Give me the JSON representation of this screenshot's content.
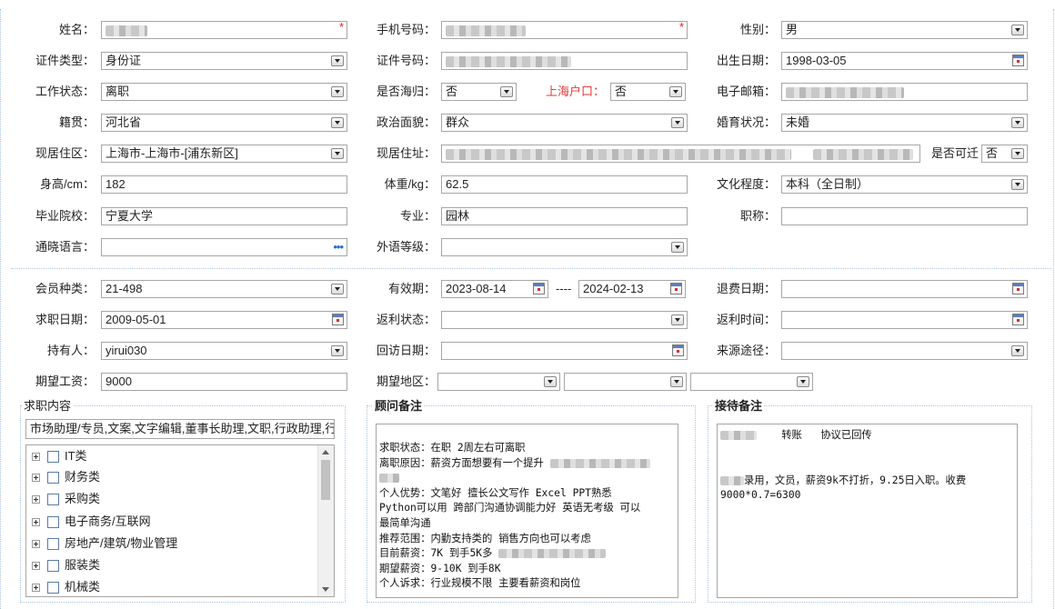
{
  "personal": {
    "name_label": "姓名：",
    "mobile_label": "手机号码：",
    "gender_label": "性别：",
    "gender": "男",
    "id_type_label": "证件类型：",
    "id_type": "身份证",
    "id_no_label": "证件号码：",
    "birth_label": "出生日期：",
    "birth": "1998-03-05",
    "work_status_label": "工作状态：",
    "work_status": "离职",
    "returnee_label": "是否海归：",
    "returnee": "否",
    "hukou_label": "上海户口：",
    "hukou": "否",
    "email_label": "电子邮箱：",
    "native_label": "籍贯：",
    "native": "河北省",
    "political_label": "政治面貌：",
    "political": "群众",
    "marital_label": "婚育状况：",
    "marital": "未婚",
    "residence_area_label": "现居住区：",
    "residence_area": "上海市-上海市-[浦东新区]",
    "address_label": "现居住址：",
    "relocate_label": "是否可迁",
    "relocate": "否",
    "height_label": "身高/cm：",
    "height": "182",
    "weight_label": "体重/kg：",
    "weight": "62.5",
    "education_label": "文化程度：",
    "education": "本科（全日制）",
    "school_label": "毕业院校：",
    "school": "宁夏大学",
    "major_label": "专业：",
    "major": "园林",
    "title_label": "职称：",
    "language_label": "通晓语言：",
    "foreign_level_label": "外语等级："
  },
  "member": {
    "type_label": "会员种类：",
    "type": "21-498",
    "valid_label": "有效期：",
    "valid_from": "2023-08-14",
    "valid_sep": "----",
    "valid_to": "2024-02-13",
    "refund_date_label": "退费日期：",
    "job_date_label": "求职日期：",
    "job_date": "2009-05-01",
    "rebate_status_label": "返利状态：",
    "rebate_time_label": "返利时间：",
    "holder_label": "持有人：",
    "holder": "yirui030",
    "visit_label": "回访日期：",
    "source_label": "来源途径：",
    "salary_label": "期望工资：",
    "salary": "9000",
    "region_label": "期望地区："
  },
  "job_panel": {
    "title": "求职内容",
    "summary": "市场助理/专员,文案,文字编辑,董事长助理,文职,行政助理,行",
    "tree": [
      "IT类",
      "财务类",
      "采购类",
      "电子商务/互联网",
      "房地产/建筑/物业管理",
      "服装类",
      "机械类"
    ]
  },
  "consultant": {
    "title": "顾问备注",
    "lines": [
      "求职状态：在职 2周左右可离职",
      "离职原因：薪资方面想要有一个提升",
      "",
      "个人优势：文笔好 擅长公文写作 Excel PPT熟悉",
      "Python可以用 跨部门沟通协调能力好 英语无考级 可以",
      "最简单沟通",
      "推荐范围：内勤支持类的 销售方向也可以考虑",
      "目前薪资：7K 到手5K多",
      "期望薪资：9-10K 到手8K",
      "个人诉求：行业规模不限 主要看薪资和岗位"
    ]
  },
  "reception": {
    "title": "接待备注",
    "line1_a": "转账",
    "line1_b": "协议已回传",
    "line2": "录用，文员，薪资9k不打折，9.25日入职。收费",
    "line3": "9000*0.7=6300"
  },
  "colors": {
    "border": "#a6a6a6",
    "section_line": "#a9c4de",
    "required": "#e02020",
    "label_red": "#e23a3a",
    "ellipsis": "#2a6fc9"
  }
}
